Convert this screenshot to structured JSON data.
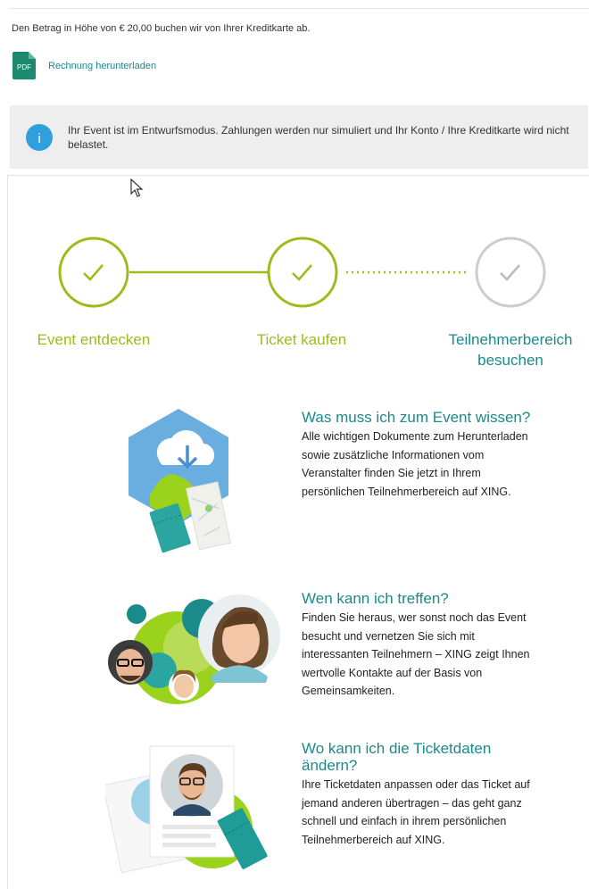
{
  "payment": {
    "amount_text": "Den Betrag in Höhe von € 20,00 buchen wir von Ihrer Kreditkarte ab.",
    "pdf_badge": "PDF",
    "invoice_link": "Rechnung herunterladen"
  },
  "notice": {
    "icon": "info-icon",
    "icon_letter": "i",
    "text": "Ihr Event ist im Entwurfsmodus. Zahlungen werden nur simuliert und Ihr Konto / Ihre Kreditkarte wird nicht belastet."
  },
  "colors": {
    "lime": "#9bbd1c",
    "teal": "#1b8a8a",
    "info_blue": "#2f9fde",
    "grey": "#cccccc",
    "notice_bg": "#eeeeee"
  },
  "steps": [
    {
      "label": "Event entdecken",
      "state": "done",
      "icon": "check-icon"
    },
    {
      "label": "Ticket kaufen",
      "state": "done",
      "icon": "check-icon"
    },
    {
      "label": "Teilnehmerbereich besuchen",
      "state": "pending",
      "icon": "check-icon"
    }
  ],
  "features": [
    {
      "title": "Was muss ich zum Event wissen?",
      "body": "Alle wichtigen Dokumente zum Herunterladen sowie zusätzliche Informationen vom Veranstalter finden Sie jetzt in Ihrem persönlichen Teilnehmerbereich auf XING.",
      "icon": "cloud-download-icon"
    },
    {
      "title": "Wen kann ich treffen?",
      "body": "Finden Sie heraus, wer sonst noch das Event besucht und vernetzen Sie sich mit interessanten Teilnehmern – XING zeigt Ihnen wertvolle Kontakte auf der Basis von Gemeinsamkeiten.",
      "icon": "people-network-icon"
    },
    {
      "title": "Wo kann ich die Ticketdaten ändern?",
      "body": "Ihre Ticketdaten anpassen oder das Ticket auf jemand anderen übertragen – das geht ganz schnell und einfach in ihrem persönlichen Teilnehmerbereich auf XING.",
      "icon": "profile-ticket-icon"
    }
  ]
}
